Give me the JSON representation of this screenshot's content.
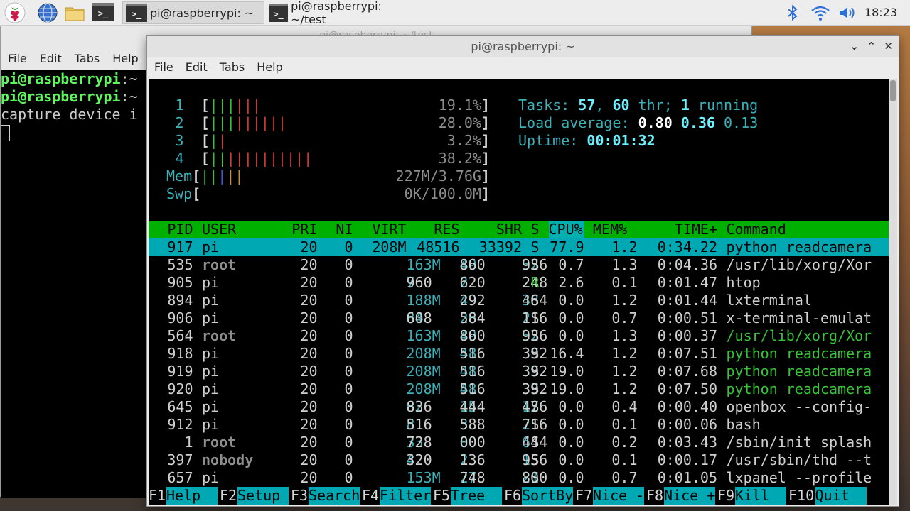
{
  "taskbar": {
    "tasks": [
      {
        "label": "pi@raspberrypi: ~",
        "active": true
      },
      {
        "label": "pi@raspberrypi: ~/test",
        "active": false
      }
    ],
    "clock": "18:23"
  },
  "back_window": {
    "title": "pi@raspberrypi: ~/test",
    "menu": [
      "File",
      "Edit",
      "Tabs",
      "Help"
    ],
    "lines": [
      {
        "prompt": "pi@raspberrypi",
        "rest": ":~"
      },
      {
        "prompt": "pi@raspberrypi",
        "rest": ":~"
      },
      {
        "prompt": "",
        "rest": "capture device i"
      }
    ]
  },
  "front_window": {
    "title": "pi@raspberrypi: ~",
    "menu": [
      "File",
      "Edit",
      "Tabs",
      "Help"
    ]
  },
  "htop": {
    "meters": [
      {
        "label": "1",
        "bars": [
          [
            "green",
            "|||"
          ],
          [
            "red",
            "|||"
          ]
        ],
        "value": "19.1%]"
      },
      {
        "label": "2",
        "bars": [
          [
            "green",
            "|||"
          ],
          [
            "red",
            "||||||"
          ]
        ],
        "value": "28.0%]"
      },
      {
        "label": "3",
        "bars": [
          [
            "green",
            "|"
          ],
          [
            "red",
            "|"
          ]
        ],
        "value": "3.2%]"
      },
      {
        "label": "4",
        "bars": [
          [
            "green",
            "||"
          ],
          [
            "red",
            "||||||||||"
          ]
        ],
        "value": "38.2%]"
      },
      {
        "label": "Mem",
        "bars": [
          [
            "green",
            "||"
          ],
          [
            "blue",
            "|"
          ],
          [
            "orange",
            "||"
          ]
        ],
        "value": "227M/3.76G]"
      },
      {
        "label": "Swp",
        "bars": [],
        "value": "0K/100.0M]"
      }
    ],
    "tasks": {
      "label": "Tasks: ",
      "count": "57",
      "sep": ", ",
      "thr": "60",
      "thr_label": " thr; ",
      "running": "1",
      "running_label": " running"
    },
    "load": {
      "label": "Load average: ",
      "v1": "0.80",
      "v5": "0.36",
      "v15": "0.13"
    },
    "uptime": {
      "label": "Uptime: ",
      "value": "00:01:32"
    },
    "columns": [
      "PID",
      "USER",
      "PRI",
      "NI",
      "VIRT",
      "RES",
      "SHR",
      "S",
      "CPU%",
      "MEM%",
      "TIME+",
      "Command"
    ],
    "processes": [
      {
        "pid": "917",
        "user": "pi",
        "pri": "20",
        "ni": "0",
        "virt": "208M",
        "res": "48516",
        "shr": "33392",
        "s": "S",
        "cpu": "77.9",
        "mem": "1.2",
        "time": "0:34.22",
        "cmd": "python readcamera",
        "selected": true
      },
      {
        "pid": "535",
        "user": "root",
        "pri": "20",
        "ni": "0",
        "virt": "163M",
        "res": "49860",
        "shr": "32936",
        "s": "S",
        "cpu": "0.7",
        "mem": "1.3",
        "time": "0:04.36",
        "cmd": "/usr/lib/xorg/Xor"
      },
      {
        "pid": "905",
        "user": "pi",
        "pri": "20",
        "ni": "0",
        "virt": "7960",
        "res": "2620",
        "shr": "2248",
        "s": "R",
        "cpu": "2.6",
        "mem": "0.1",
        "time": "0:01.47",
        "cmd": "htop"
      },
      {
        "pid": "894",
        "user": "pi",
        "pri": "20",
        "ni": "0",
        "virt": "188M",
        "res": "49292",
        "shr": "38464",
        "s": "S",
        "cpu": "0.0",
        "mem": "1.2",
        "time": "0:01.44",
        "cmd": "lxterminal"
      },
      {
        "pid": "906",
        "user": "pi",
        "pri": "20",
        "ni": "0",
        "virt": "84608",
        "res": "26584",
        "shr": "21116",
        "s": "S",
        "cpu": "0.0",
        "mem": "0.7",
        "time": "0:00.51",
        "cmd": "x-terminal-emulat"
      },
      {
        "pid": "564",
        "user": "root",
        "pri": "20",
        "ni": "0",
        "virt": "163M",
        "res": "49860",
        "shr": "32936",
        "s": "S",
        "cpu": "0.0",
        "mem": "1.3",
        "time": "0:00.37",
        "cmd": "/usr/lib/xorg/Xor",
        "thread": true
      },
      {
        "pid": "918",
        "user": "pi",
        "pri": "20",
        "ni": "0",
        "virt": "208M",
        "res": "48516",
        "shr": "33392",
        "s": "S",
        "cpu": "16.4",
        "mem": "1.2",
        "time": "0:07.51",
        "cmd": "python readcamera",
        "thread": true
      },
      {
        "pid": "919",
        "user": "pi",
        "pri": "20",
        "ni": "0",
        "virt": "208M",
        "res": "48516",
        "shr": "33392",
        "s": "S",
        "cpu": "19.0",
        "mem": "1.2",
        "time": "0:07.68",
        "cmd": "python readcamera",
        "thread": true
      },
      {
        "pid": "920",
        "user": "pi",
        "pri": "20",
        "ni": "0",
        "virt": "208M",
        "res": "48516",
        "shr": "33392",
        "s": "S",
        "cpu": "19.0",
        "mem": "1.2",
        "time": "0:07.50",
        "cmd": "python readcamera",
        "thread": true
      },
      {
        "pid": "645",
        "user": "pi",
        "pri": "20",
        "ni": "0",
        "virt": "62836",
        "res": "15444",
        "shr": "12476",
        "s": "S",
        "cpu": "0.0",
        "mem": "0.4",
        "time": "0:00.40",
        "cmd": "openbox --config-"
      },
      {
        "pid": "912",
        "user": "pi",
        "pri": "20",
        "ni": "0",
        "virt": "8516",
        "res": "3588",
        "shr": "2716",
        "s": "S",
        "cpu": "0.0",
        "mem": "0.1",
        "time": "0:00.06",
        "cmd": "bash"
      },
      {
        "pid": "1",
        "user": "root",
        "pri": "20",
        "ni": "0",
        "virt": "33728",
        "res": "8000",
        "shr": "6444",
        "s": "S",
        "cpu": "0.0",
        "mem": "0.2",
        "time": "0:03.43",
        "cmd": "/sbin/init splash"
      },
      {
        "pid": "397",
        "user": "nobody",
        "pri": "20",
        "ni": "0",
        "virt": "4320",
        "res": "2136",
        "shr": "1956",
        "s": "S",
        "cpu": "0.0",
        "mem": "0.1",
        "time": "0:00.17",
        "cmd": "/usr/sbin/thd --t"
      },
      {
        "pid": "657",
        "user": "pi",
        "pri": "20",
        "ni": "0",
        "virt": "153M",
        "res": "27748",
        "shr": "21800",
        "s": "S",
        "cpu": "0.0",
        "mem": "0.7",
        "time": "0:01.05",
        "cmd": "lxpanel --profile"
      }
    ],
    "fkeys": [
      {
        "key": "F1",
        "label": "Help  "
      },
      {
        "key": "F2",
        "label": "Setup "
      },
      {
        "key": "F3",
        "label": "Search"
      },
      {
        "key": "F4",
        "label": "Filter"
      },
      {
        "key": "F5",
        "label": "Tree  "
      },
      {
        "key": "F6",
        "label": "SortBy"
      },
      {
        "key": "F7",
        "label": "Nice -"
      },
      {
        "key": "F8",
        "label": "Nice +"
      },
      {
        "key": "F9",
        "label": "Kill  "
      },
      {
        "key": "F10",
        "label": "Quit  "
      }
    ]
  },
  "colors": {
    "header_green": "#00b000",
    "selected_cyan": "#00a8b4",
    "prompt_green": "#5ef55e"
  }
}
